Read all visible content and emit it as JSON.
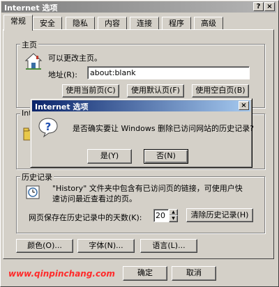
{
  "window": {
    "title": "Internet 选项",
    "help_button": "?",
    "close_button": "×"
  },
  "tabs": [
    {
      "label": "常规",
      "active": true
    },
    {
      "label": "安全"
    },
    {
      "label": "隐私"
    },
    {
      "label": "内容"
    },
    {
      "label": "连接"
    },
    {
      "label": "程序"
    },
    {
      "label": "高级"
    }
  ],
  "homepage": {
    "legend": "主页",
    "description": "可以更改主页。",
    "address_label": "地址(R):",
    "address_value": "about:blank",
    "buttons": {
      "use_current": "使用当前页(C)",
      "use_default": "使用默认页(F)",
      "use_blank": "使用空白页(B)"
    }
  },
  "temp_files": {
    "legend_partial": "Int"
  },
  "history": {
    "legend": "历史记录",
    "description_line1": "\"History\" 文件夹中包含有已访问页的链接，可使用户快",
    "description_line2": "速访问最近查看过的页。",
    "days_label": "网页保存在历史记录中的天数(K):",
    "days_value": "20",
    "clear_button": "清除历史记录(H)"
  },
  "bottom_buttons": {
    "colors": "颜色(O)...",
    "fonts": "字体(N)...",
    "languages": "语言(L)..."
  },
  "footer_buttons": {
    "ok": "确定",
    "cancel": "取消"
  },
  "watermark": "www.qinpinchang.com",
  "dialog": {
    "title": "Internet 选项",
    "close_button": "×",
    "message": "是否确实要让 Windows 删除已访问网站的历史记录?",
    "yes": "是(Y)",
    "no": "否(N)",
    "icon": "question-icon"
  }
}
